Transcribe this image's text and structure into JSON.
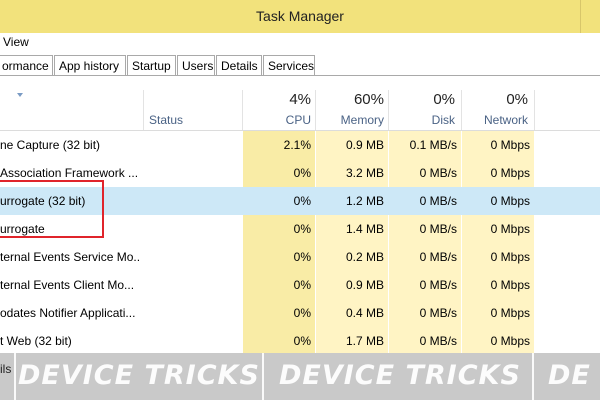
{
  "window": {
    "title": "Task Manager"
  },
  "menubar": {
    "view_label": "View"
  },
  "tabs": [
    {
      "label": "ormance"
    },
    {
      "label": "App history"
    },
    {
      "label": "Startup"
    },
    {
      "label": "Users"
    },
    {
      "label": "Details"
    },
    {
      "label": "Services"
    }
  ],
  "columns": {
    "status": "Status",
    "cpu": {
      "pct": "4%",
      "label": "CPU"
    },
    "memory": {
      "pct": "60%",
      "label": "Memory"
    },
    "disk": {
      "pct": "0%",
      "label": "Disk"
    },
    "network": {
      "pct": "0%",
      "label": "Network"
    }
  },
  "rows": [
    {
      "name": "ne Capture (32 bit)",
      "cpu": "2.1%",
      "memory": "0.9 MB",
      "disk": "0.1 MB/s",
      "network": "0 Mbps"
    },
    {
      "name": "Association Framework ...",
      "cpu": "0%",
      "memory": "3.2 MB",
      "disk": "0 MB/s",
      "network": "0 Mbps"
    },
    {
      "name": "urrogate (32 bit)",
      "cpu": "0%",
      "memory": "1.2 MB",
      "disk": "0 MB/s",
      "network": "0 Mbps",
      "selected": true
    },
    {
      "name": "urrogate",
      "cpu": "0%",
      "memory": "1.4 MB",
      "disk": "0 MB/s",
      "network": "0 Mbps"
    },
    {
      "name": "ternal Events Service Mo...",
      "cpu": "0%",
      "memory": "0.2 MB",
      "disk": "0 MB/s",
      "network": "0 Mbps"
    },
    {
      "name": "ternal Events Client Mo...",
      "cpu": "0%",
      "memory": "0.9 MB",
      "disk": "0 MB/s",
      "network": "0 Mbps"
    },
    {
      "name": "odates Notifier Applicati...",
      "cpu": "0%",
      "memory": "0.4 MB",
      "disk": "0 MB/s",
      "network": "0 Mbps"
    },
    {
      "name": "t Web (32 bit)",
      "cpu": "0%",
      "memory": "1.7 MB",
      "disk": "0 MB/s",
      "network": "0 Mbps"
    }
  ],
  "footer": {
    "label": "ils"
  },
  "watermark": {
    "text": "DEVICE TRICKS",
    "partial": "DE"
  },
  "colors": {
    "titlebar": "#f2e27c",
    "selected_row": "#cde8f7",
    "heat_light": "#fff4c4",
    "highlight_box": "#e0242b"
  }
}
